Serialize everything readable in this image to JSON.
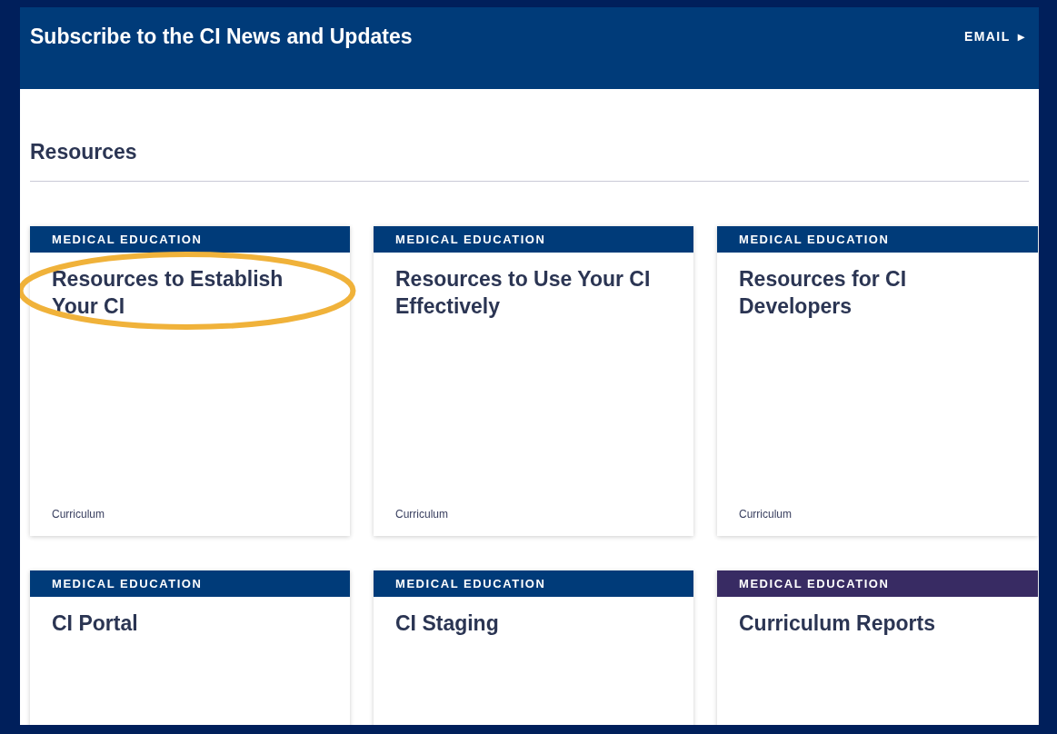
{
  "banner": {
    "title": "Subscribe to the CI News and Updates",
    "link": "EMAIL",
    "link_icon": "▸"
  },
  "section": {
    "title": "Resources"
  },
  "cards": [
    {
      "tag": "MEDICAL EDUCATION",
      "color": "#003b79",
      "title": "Resources to Establish Your CI",
      "footer": "Curriculum",
      "highlighted": true
    },
    {
      "tag": "MEDICAL EDUCATION",
      "color": "#003b79",
      "title": "Resources to Use Your CI Effectively",
      "footer": "Curriculum",
      "highlighted": false
    },
    {
      "tag": "MEDICAL EDUCATION",
      "color": "#003b79",
      "title": "Resources for CI Developers",
      "footer": "Curriculum",
      "highlighted": false
    },
    {
      "tag": "MEDICAL EDUCATION",
      "color": "#003b79",
      "title": "CI Portal",
      "highlighted": false
    },
    {
      "tag": "MEDICAL EDUCATION",
      "color": "#003b79",
      "title": "CI Staging",
      "highlighted": false
    },
    {
      "tag": "MEDICAL EDUCATION",
      "color": "#382b63",
      "title": "Curriculum Reports",
      "highlighted": false
    }
  ]
}
